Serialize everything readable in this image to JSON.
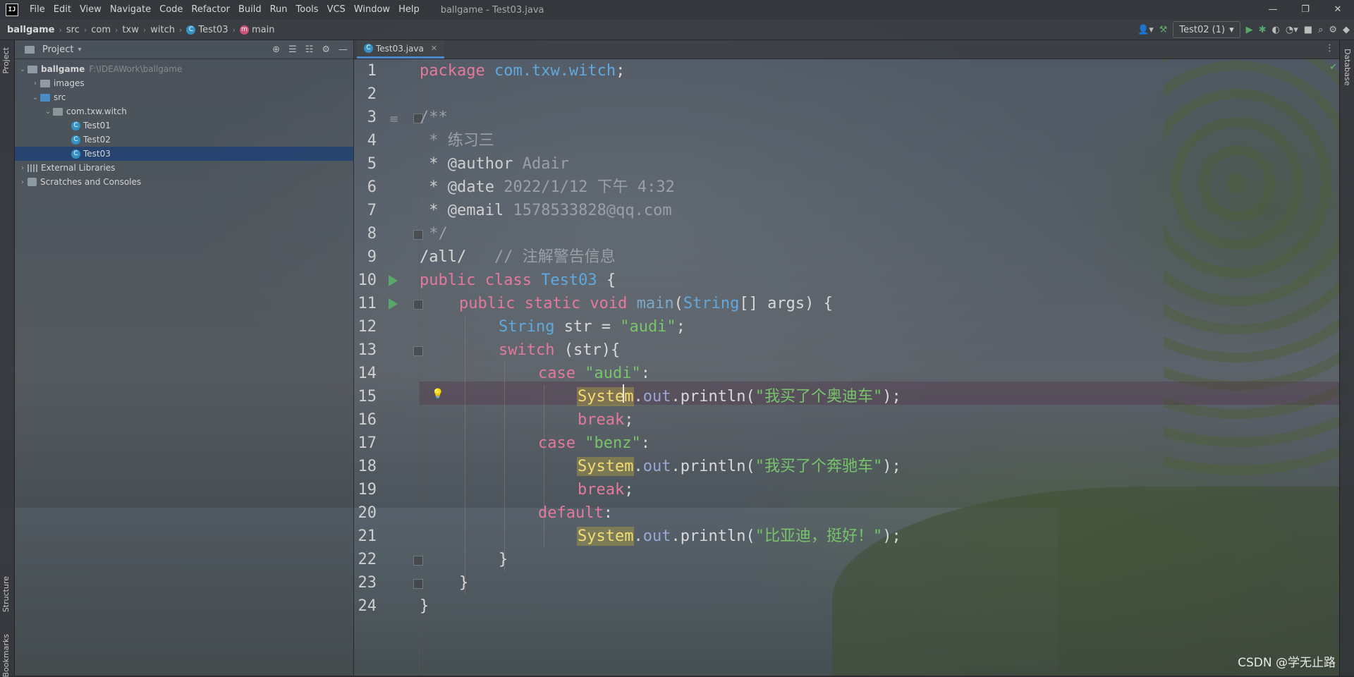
{
  "window": {
    "title": "ballgame - Test03.java",
    "menu": [
      "File",
      "Edit",
      "View",
      "Navigate",
      "Code",
      "Refactor",
      "Build",
      "Run",
      "Tools",
      "VCS",
      "Window",
      "Help"
    ],
    "controls": [
      "—",
      "❐",
      "✕"
    ]
  },
  "breadcrumb": [
    "ballgame",
    "src",
    "com",
    "txw",
    "witch",
    "Test03",
    "main"
  ],
  "toolbar": {
    "run_config": "Test02 (1)"
  },
  "project_panel": {
    "title": "Project",
    "tree": [
      {
        "label": "ballgame",
        "hint": "F:\\IDEAWork\\ballgame"
      },
      {
        "label": "images"
      },
      {
        "label": "src"
      },
      {
        "label": "com.txw.witch"
      },
      {
        "label": "Test01"
      },
      {
        "label": "Test02"
      },
      {
        "label": "Test03"
      },
      {
        "label": "External Libraries"
      },
      {
        "label": "Scratches and Consoles"
      }
    ]
  },
  "side_tabs": {
    "left_top": "Project",
    "left_structure": "Structure",
    "left_bookmarks": "Bookmarks",
    "right": "Database"
  },
  "editor": {
    "tab_label": "Test03.java",
    "line_numbers": [
      "1",
      "2",
      "3",
      "4",
      "5",
      "6",
      "7",
      "8",
      "9",
      "10",
      "11",
      "12",
      "13",
      "14",
      "15",
      "16",
      "17",
      "18",
      "19",
      "20",
      "21",
      "22",
      "23",
      "24"
    ],
    "tokens": {
      "l1_kw": "package",
      "l1_pkg": "com.txw.witch",
      "semicolon": ";",
      "l3": "/**",
      "l4": " * 练习三",
      "l5_tag": " * @author",
      "l5_val": " Adair",
      "l6_tag": " * @date",
      "l6_val": " 2022/1/12 下午 4:32",
      "l7_tag": " * @email",
      "l7_val": " 1578533828@qq.com",
      "l8": " */",
      "l9_code": "/all/",
      "l9_cmt": "   // 注解警告信息",
      "l10_kw": "public class ",
      "l10_cls": "Test03",
      "l10_end": " {",
      "l11_kw": "public static void ",
      "l11_mth": "main",
      "l11_p1": "(",
      "l11_type": "String",
      "l11_rest": "[] args) {",
      "l12_type": "String",
      "l12_mid": " str = ",
      "l12_str": "\"audi\"",
      "l13_kw": "switch",
      "l13_rest": " (str){",
      "case_kw": "case ",
      "l14_str": "\"audi\"",
      "colon": ":",
      "sys": "System",
      "dot": ".",
      "out": "out",
      "println_open": ".println(",
      "l15_str": "\"我买了个奥迪车\"",
      "close_call": ");",
      "break_kw": "break",
      "l17_str": "\"benz\"",
      "l18_str": "\"我买了个奔驰车\"",
      "default_kw": "default",
      "l21_str": "\"比亚迪，挺好！\"",
      "brace_close": "}"
    }
  },
  "watermark": "CSDN @学无止路"
}
